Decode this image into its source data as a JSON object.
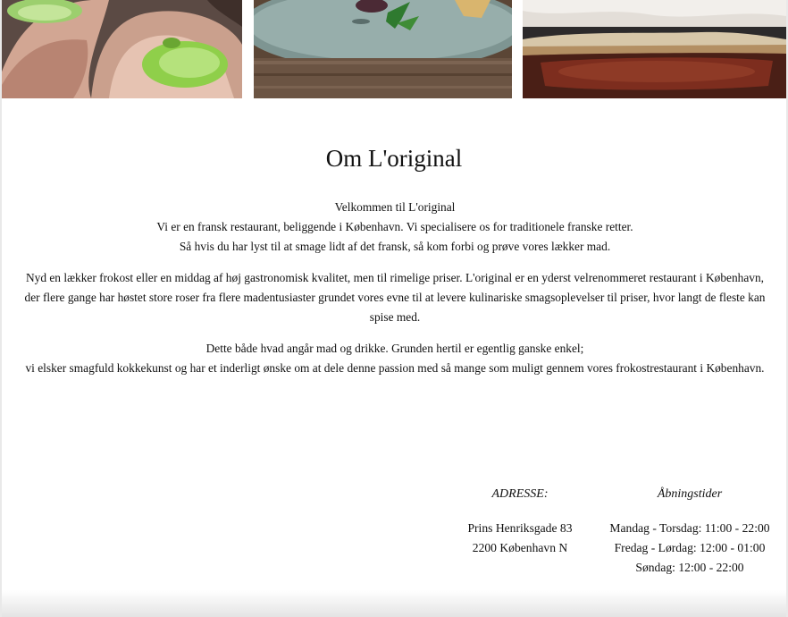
{
  "about": {
    "title": "Om L'original",
    "paragraphs": [
      [
        "Velkommen til L'original",
        "Vi er en fransk restaurant, beliggende i København. Vi specialisere os for traditionele franske retter.",
        "Så hvis du har lyst til at smage lidt af det fransk, så kom forbi og prøve vores lækker mad."
      ],
      [
        "Nyd en lækker frokost eller en middag af høj gastronomisk kvalitet, men til rimelige priser. L'original er en yderst velrenommeret restaurant i København,",
        "der flere gange har høstet store roser fra flere madentusiaster grundet vores evne til at levere kulinariske smagsoplevelser til priser, hvor langt de fleste kan spise med."
      ],
      [
        "Dette både hvad angår mad og drikke. Grunden hertil er egentlig ganske enkel;",
        "vi elsker smagfuld kokkekunst og har et inderligt ønske om at dele denne passion med så mange som muligt gennem vores frokostrestaurant i København."
      ]
    ]
  },
  "address": {
    "heading": "ADRESSE:",
    "lines": [
      "Prins Henriksgade 83",
      "2200 København N"
    ]
  },
  "hours": {
    "heading": "Åbningstider",
    "lines": [
      "Mandag - Torsdag: 11:00 - 22:00",
      "Fredag - Lørdag: 12:00 - 01:00",
      "Søndag: 12:00 - 22:00"
    ]
  }
}
